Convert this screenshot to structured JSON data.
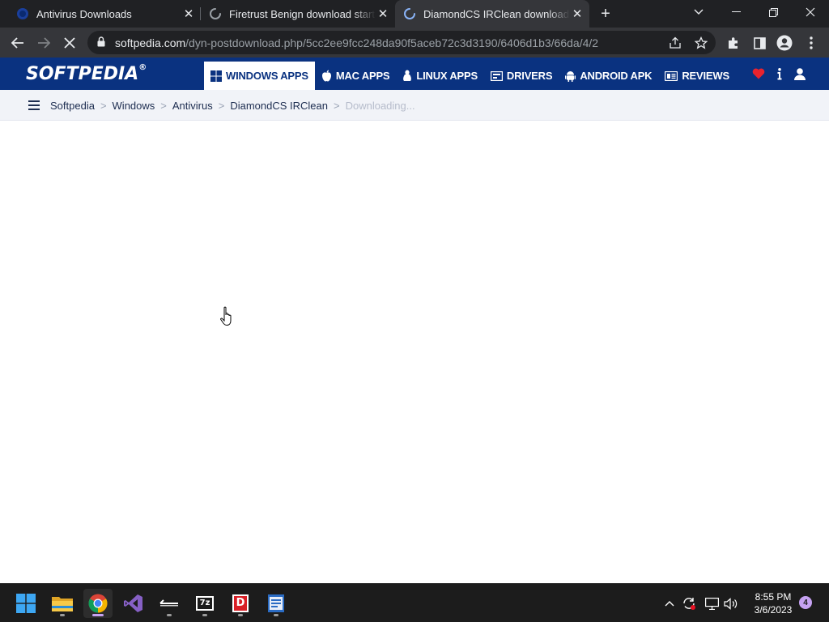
{
  "browser": {
    "tabs": [
      {
        "title": "Antivirus Downloads",
        "favicon": "softpedia-favicon",
        "state": "loaded"
      },
      {
        "title": "Firetrust Benign download starting",
        "favicon": "loading-spinner-icon",
        "state": "loading"
      },
      {
        "title": "DiamondCS IRClean download starting",
        "favicon": "loading-spinner-icon",
        "state": "loading",
        "active": true
      }
    ],
    "url_host": "softpedia.com",
    "url_path": "/dyn-postdownload.php/5cc2ee9fcc248da90f5aceb72c3d3190/6406d1b3/66da/4/2"
  },
  "site": {
    "logo_text": "SOFTPEDIA",
    "logo_mark": "®",
    "nav": [
      {
        "label": "WINDOWS APPS",
        "icon": "windows-icon",
        "active": true
      },
      {
        "label": "MAC APPS",
        "icon": "apple-icon"
      },
      {
        "label": "LINUX APPS",
        "icon": "linux-icon"
      },
      {
        "label": "DRIVERS",
        "icon": "drivers-icon"
      },
      {
        "label": "ANDROID APK",
        "icon": "android-icon"
      },
      {
        "label": "REVIEWS",
        "icon": "reviews-icon"
      }
    ],
    "breadcrumb": [
      "Softpedia",
      "Windows",
      "Antivirus",
      "DiamondCS IRClean"
    ],
    "breadcrumb_current": "Downloading..."
  },
  "taskbar": {
    "apps": [
      "start-icon",
      "file-explorer-icon",
      "chrome-icon",
      "visual-studio-icon",
      "terminal-icon",
      "7zip-icon",
      "red-d-app-icon",
      "document-app-icon"
    ],
    "seven_zip_label": "7z",
    "d_label": "D",
    "time": "8:55 PM",
    "date": "3/6/2023",
    "notification_count": "4"
  },
  "colors": {
    "brand_blue": "#0a3280",
    "tab_strip": "#202124",
    "toolbar": "#35363a",
    "accent_purple": "#c6a2f2"
  }
}
